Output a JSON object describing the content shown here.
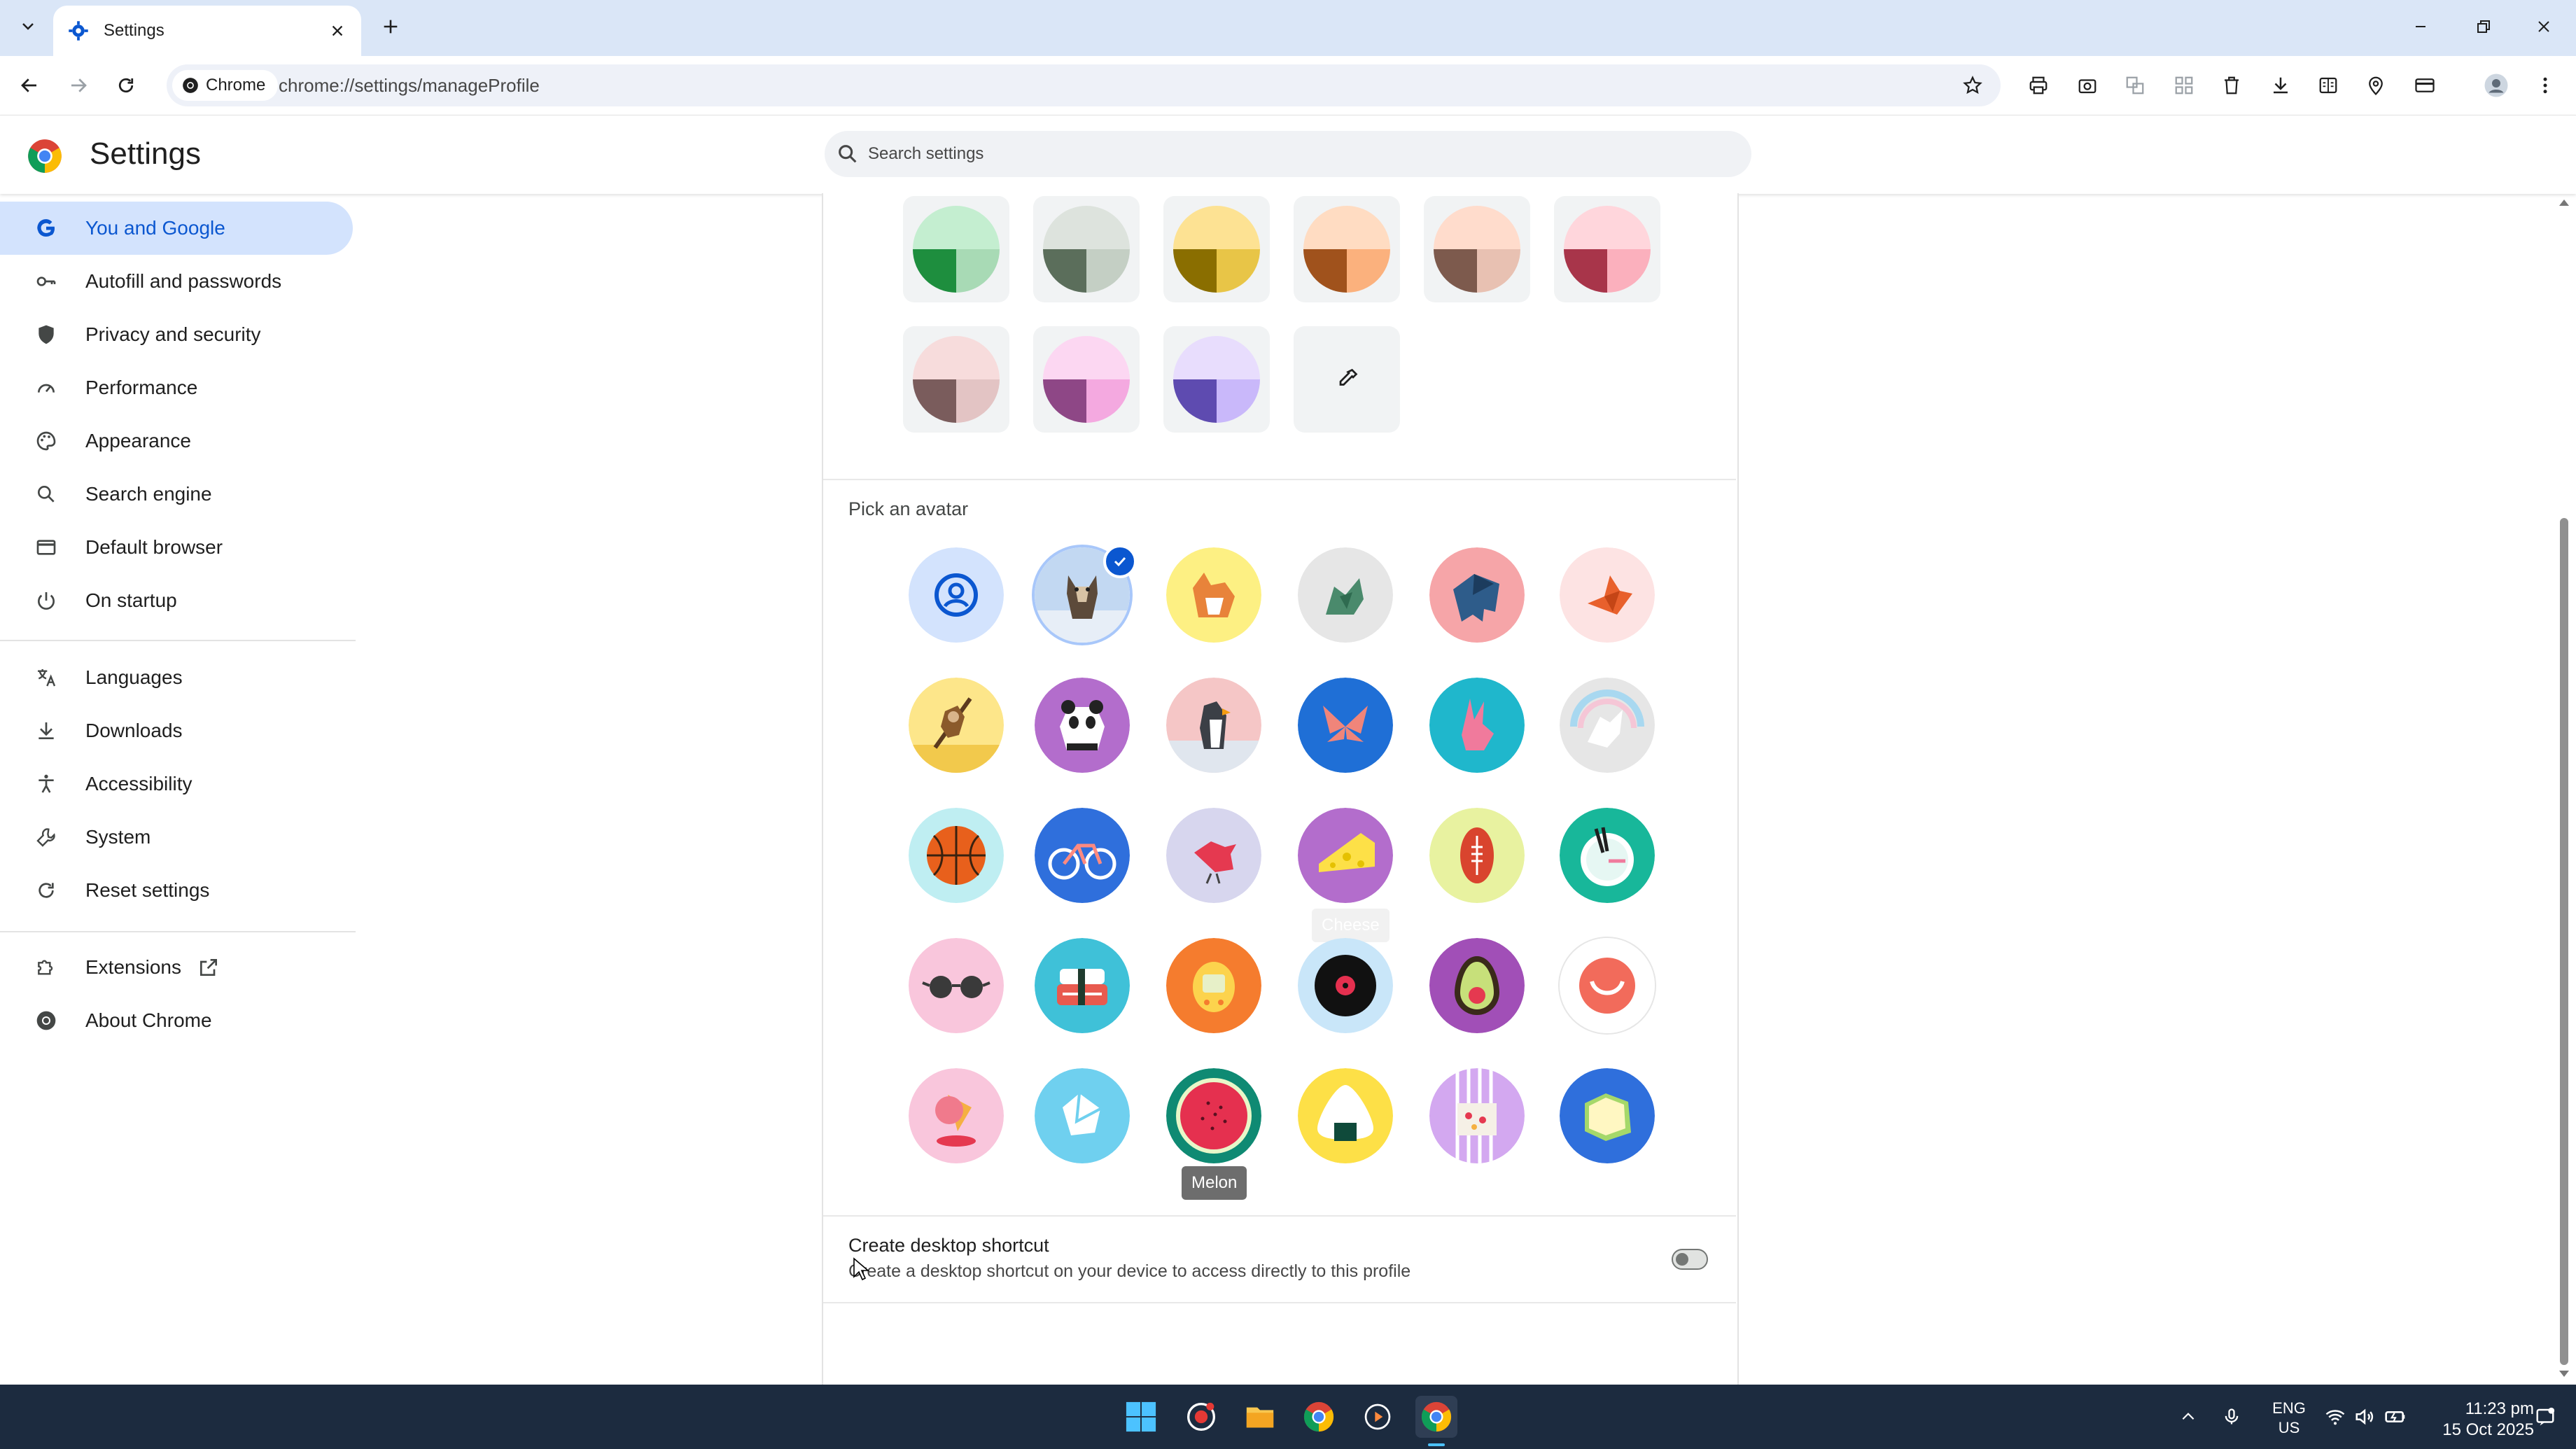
{
  "browser": {
    "tab_title": "Settings",
    "chip_label": "Chrome",
    "url": "chrome://settings/manageProfile"
  },
  "header": {
    "title": "Settings",
    "search_placeholder": "Search settings"
  },
  "sidebar": {
    "items": [
      {
        "label": "You and Google",
        "icon": "google-g-icon",
        "active": true
      },
      {
        "label": "Autofill and passwords",
        "icon": "key-icon"
      },
      {
        "label": "Privacy and security",
        "icon": "shield-icon"
      },
      {
        "label": "Performance",
        "icon": "speedometer-icon"
      },
      {
        "label": "Appearance",
        "icon": "palette-icon"
      },
      {
        "label": "Search engine",
        "icon": "search-icon"
      },
      {
        "label": "Default browser",
        "icon": "browser-window-icon"
      },
      {
        "label": "On startup",
        "icon": "power-icon"
      },
      {
        "label": "Languages",
        "icon": "translate-icon"
      },
      {
        "label": "Downloads",
        "icon": "download-icon"
      },
      {
        "label": "Accessibility",
        "icon": "accessibility-icon"
      },
      {
        "label": "System",
        "icon": "wrench-icon"
      },
      {
        "label": "Reset settings",
        "icon": "reset-icon"
      },
      {
        "label": "Extensions",
        "icon": "puzzle-icon"
      },
      {
        "label": "About Chrome",
        "icon": "chrome-icon"
      }
    ]
  },
  "colors": {
    "accent": "#0b57d0",
    "active_nav_bg": "#d3e3fd",
    "swatches_row1": [
      {
        "top": "#c4eed0",
        "left": "#1e8e3e",
        "right": "#a8dab5"
      },
      {
        "top": "#dde3dd",
        "left": "#5b6e5b",
        "right": "#c4cfc4"
      },
      {
        "top": "#fde293",
        "left": "#8a6e00",
        "right": "#e8c547"
      },
      {
        "top": "#ffdcc2",
        "left": "#a0521c",
        "right": "#fbb17d"
      },
      {
        "top": "#ffdccc",
        "left": "#7d5a4d",
        "right": "#e8c1b2"
      },
      {
        "top": "#ffd6dc",
        "left": "#a8354a",
        "right": "#fbb0bd"
      }
    ],
    "swatches_row2": [
      {
        "top": "#f7dcdc",
        "left": "#7a5c5c",
        "right": "#e3c4c4"
      },
      {
        "top": "#fcd7f2",
        "left": "#8e4786",
        "right": "#f4a9e0"
      },
      {
        "top": "#e8ddfd",
        "left": "#5e4bb0",
        "right": "#c9b8fa"
      }
    ]
  },
  "avatar_section": {
    "label": "Pick an avatar",
    "avatars": [
      [
        "Generic",
        "Cat",
        "Corgi",
        "Dragon",
        "Elephant",
        "Fox"
      ],
      [
        "Monkey",
        "Panda",
        "Penguin",
        "Butterfly",
        "Rabbit",
        "Unicorn"
      ],
      [
        "Basketball",
        "Bike",
        "Bird",
        "Cheese",
        "Football",
        "Ramen"
      ],
      [
        "Sunglasses",
        "Sushi",
        "Tamagotchi",
        "Vinyl",
        "Avocado",
        "Smiley"
      ],
      [
        "Ice cream",
        "Ice",
        "Melon",
        "Onigiri",
        "Pizza",
        "Sandwich"
      ]
    ],
    "selected": "Cat",
    "tooltip_melon": "Melon",
    "tooltip_cheese": "Cheese"
  },
  "shortcut": {
    "title": "Create desktop shortcut",
    "description": "Create a desktop shortcut on your device to access directly to this profile",
    "enabled": false
  },
  "taskbar": {
    "lang_top": "ENG",
    "lang_bottom": "US",
    "time": "11:23 pm",
    "date": "15 Oct 2025"
  }
}
